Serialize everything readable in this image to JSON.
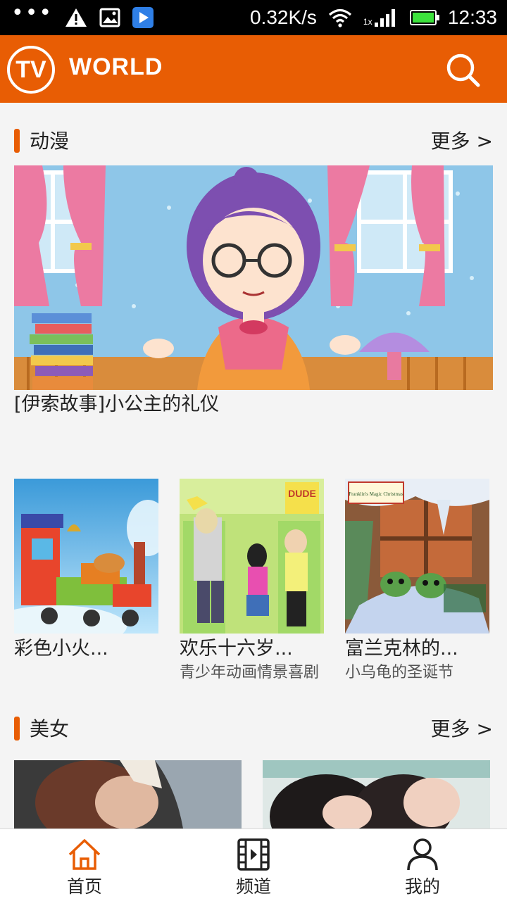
{
  "status_bar": {
    "dots": "•••",
    "net_speed": "0.32K/s",
    "signal_label": "1x",
    "time": "12:33",
    "battery_level": 1.0
  },
  "app_bar": {
    "logo_text": "TV",
    "brand": "WORLD",
    "brand_color": "#e85d04"
  },
  "sections": {
    "anime": {
      "title": "动漫",
      "more": "更多 >",
      "featured": {
        "title": "[伊索故事]小公主的礼仪"
      },
      "cards": [
        {
          "title": "彩色小火...",
          "subtitle": ""
        },
        {
          "title": "欢乐十六岁...",
          "subtitle": "青少年动画情景喜剧"
        },
        {
          "title": "富兰克林的...",
          "subtitle": "小乌龟的圣诞节"
        }
      ],
      "card_logo_1": "DUDE",
      "card_logo_2": "Franklin's Magic Christmas"
    },
    "beauty": {
      "title": "美女",
      "more": "更多 >"
    }
  },
  "bottom_nav": {
    "items": [
      {
        "label": "首页",
        "icon": "home-icon",
        "active": true
      },
      {
        "label": "频道",
        "icon": "film-icon",
        "active": false
      },
      {
        "label": "我的",
        "icon": "person-icon",
        "active": false
      }
    ],
    "active_color": "#e85d04"
  }
}
